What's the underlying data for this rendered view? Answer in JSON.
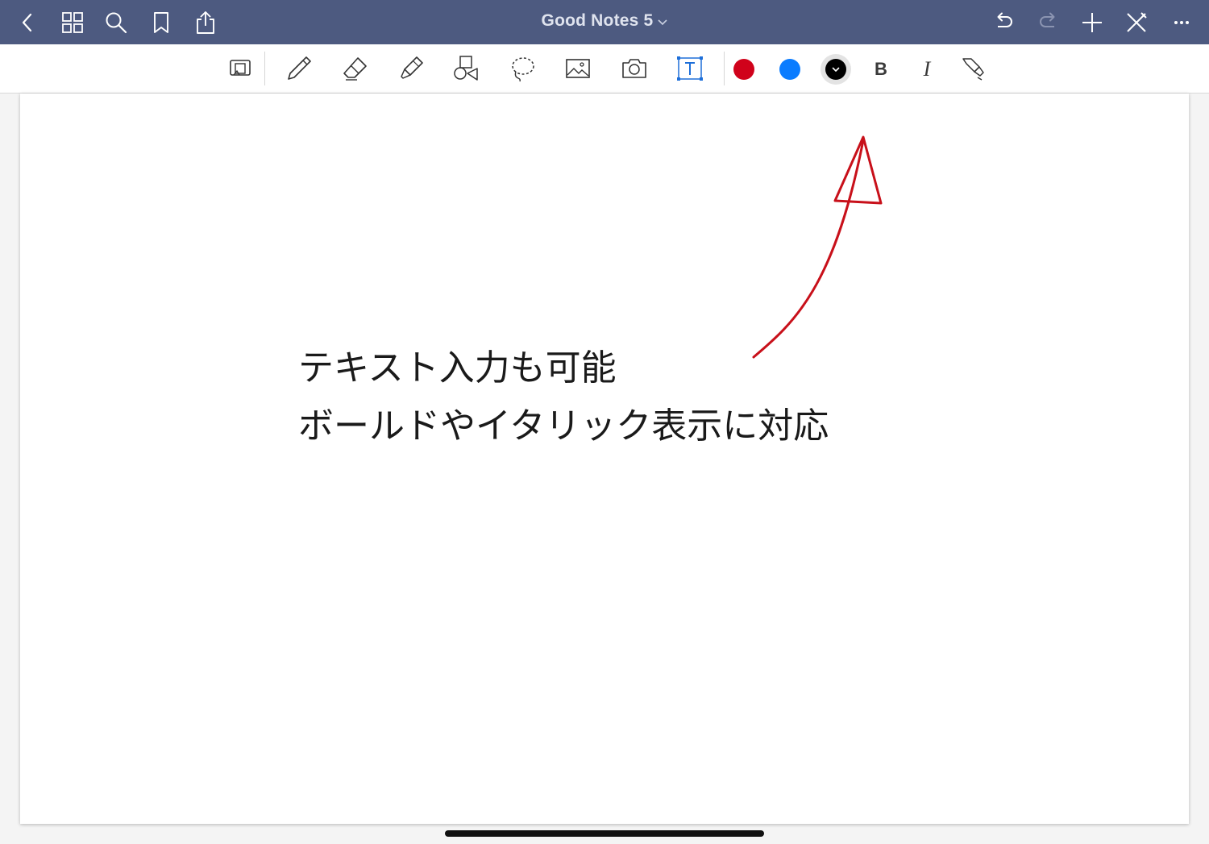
{
  "app": {
    "title": "Good Notes 5"
  },
  "navbar": {
    "left_icons": [
      "back-chevron-icon",
      "thumbnails-grid-icon",
      "search-icon",
      "bookmark-icon",
      "share-icon"
    ],
    "right_icons": [
      "undo-icon",
      "redo-icon",
      "add-page-icon",
      "close-edit-icon",
      "more-icon"
    ]
  },
  "toolbar": {
    "tools": [
      "read-mode-icon",
      "pen-icon",
      "eraser-icon",
      "highlighter-icon",
      "shapes-icon",
      "lasso-icon",
      "image-icon",
      "camera-icon",
      "text-box-icon"
    ],
    "active_tool": "text-box-icon",
    "colors": [
      "#d0021b",
      "#0a7cff",
      "#000000"
    ],
    "selected_color": "#000000",
    "bold_label": "B",
    "italic_label": "I",
    "format_icon": "text-format-brush-icon"
  },
  "theme": {
    "navbar": "#4d5a80",
    "accent": "#1e6fd9",
    "ink_red": "#c8101a"
  },
  "page": {
    "lines": [
      "テキスト入力も可能",
      "ボールドやイタリック表示に対応"
    ]
  }
}
